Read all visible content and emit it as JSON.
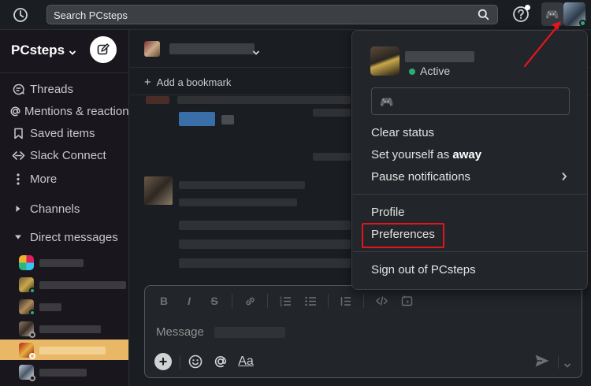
{
  "topbar": {
    "search_placeholder": "Search PCsteps",
    "icons": [
      "history-icon",
      "search-icon",
      "help-icon"
    ]
  },
  "sidebar": {
    "workspace_name": "PCsteps",
    "items": [
      {
        "label": "Threads",
        "icon": "threads-icon"
      },
      {
        "label": "Mentions & reactions",
        "icon": "at-icon"
      },
      {
        "label": "Saved items",
        "icon": "bookmark-icon"
      },
      {
        "label": "Slack Connect",
        "icon": "slack-connect-icon"
      },
      {
        "label": "More",
        "icon": "more-vertical-icon"
      }
    ],
    "sections": {
      "channels": "Channels",
      "direct_messages": "Direct messages"
    }
  },
  "channel": {
    "add_bookmark": "Add a bookmark"
  },
  "composer": {
    "placeholder": "Message",
    "format_icons": [
      "bold",
      "italic",
      "strike",
      "link",
      "ordered-list",
      "bullet-list",
      "blockquote",
      "code",
      "code-block"
    ],
    "text_format_label": "Aa"
  },
  "user_menu": {
    "status_label": "Active",
    "items": {
      "clear_status": "Clear status",
      "set_away_prefix": "Set yourself as",
      "set_away_bold": "away",
      "pause_notifications": "Pause notifications",
      "profile": "Profile",
      "preferences": "Preferences",
      "sign_out": "Sign out of PCsteps"
    }
  },
  "colors": {
    "accent_active_dm": "#e8b866",
    "status_active": "#2bac76",
    "highlight": "#e0161f",
    "background": "#1a1d21"
  }
}
